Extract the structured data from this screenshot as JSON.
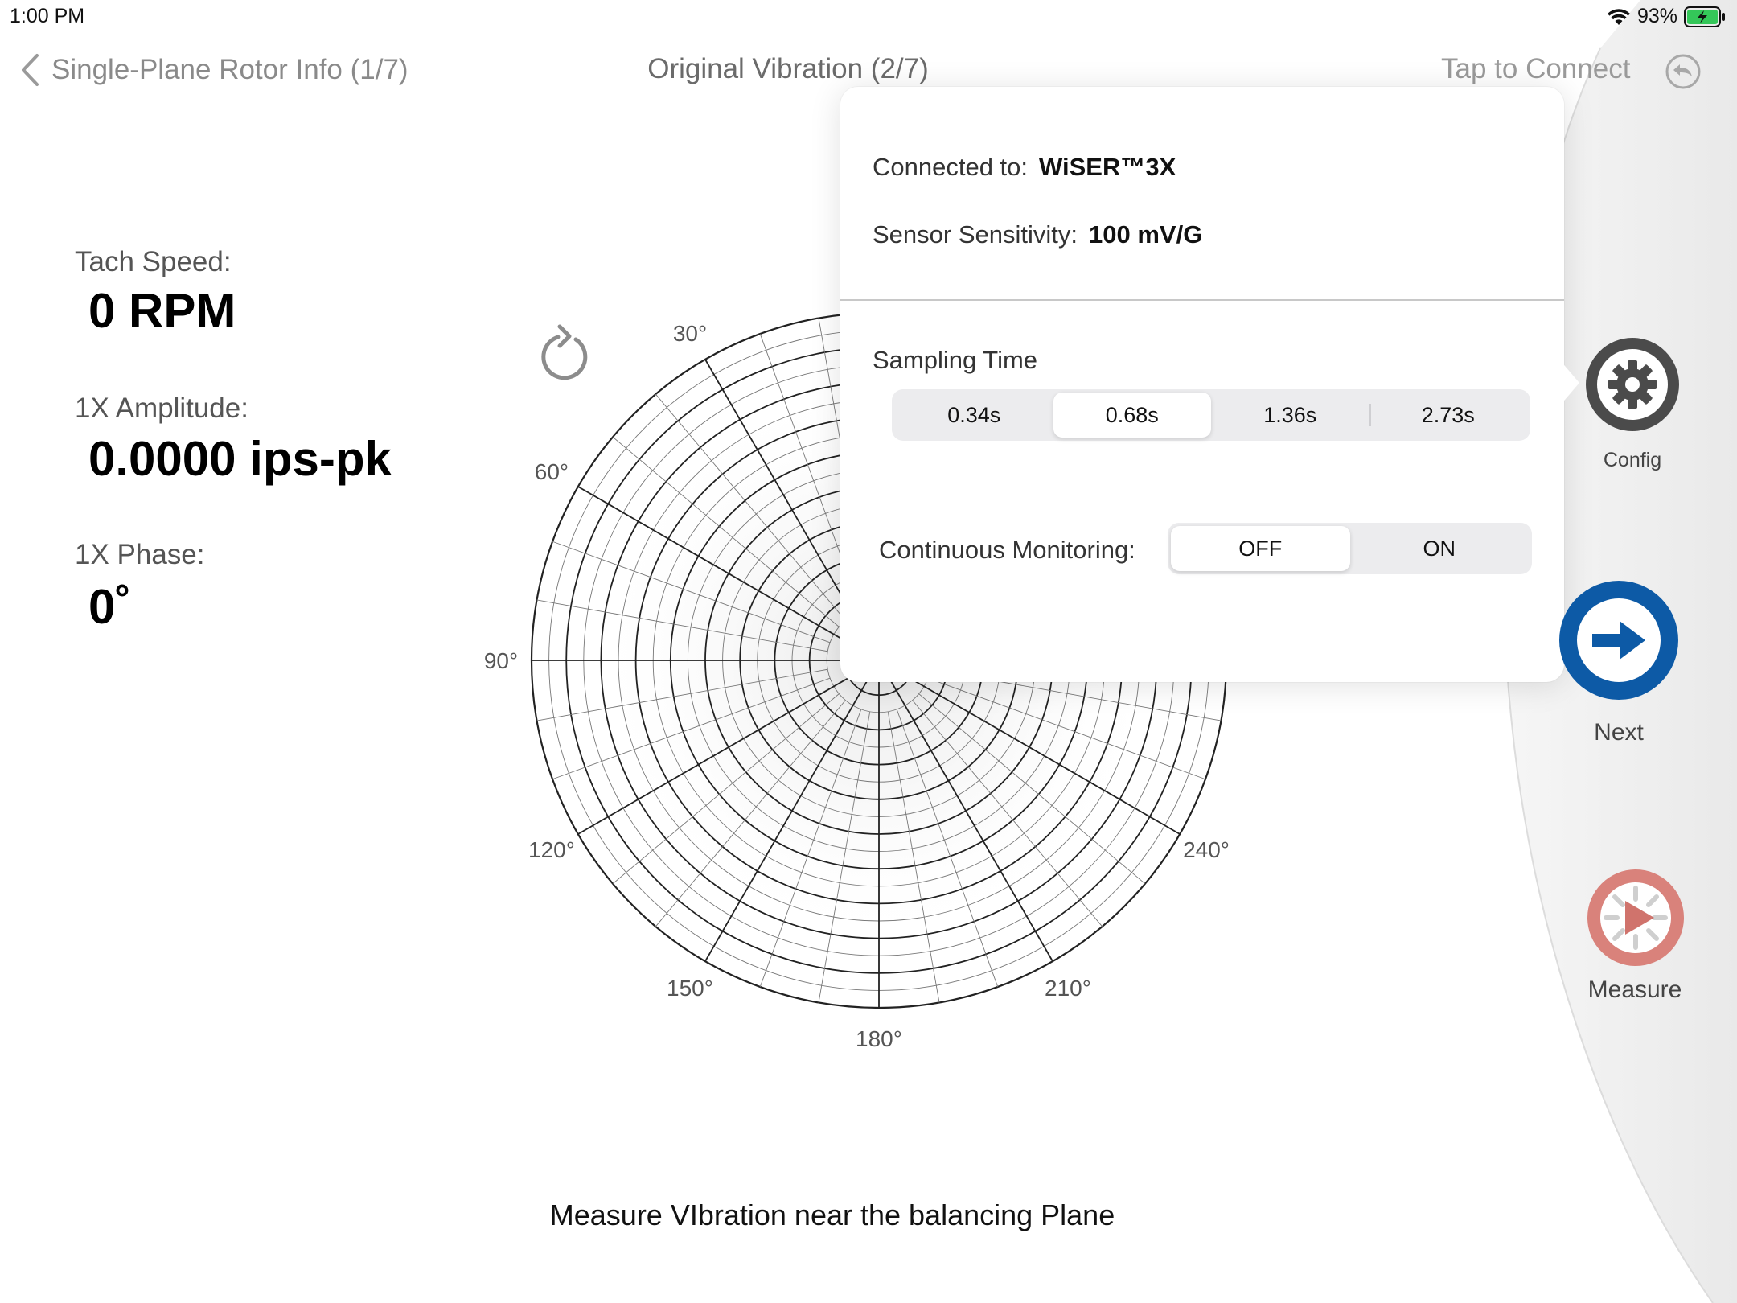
{
  "status_bar": {
    "time": "1:00 PM",
    "battery": "93%"
  },
  "nav": {
    "back_label": "Single-Plane Rotor Info (1/7)",
    "title": "Original Vibration (2/7)",
    "connect_label": "Tap to Connect"
  },
  "readouts": {
    "tach_label": "Tach Speed:",
    "tach_value": "0 RPM",
    "amplitude_label": "1X Amplitude:",
    "amplitude_value": "0.0000 ips-pk",
    "phase_label": "1X Phase:",
    "phase_value": "0˚"
  },
  "polar": {
    "angle_labels": [
      "30°",
      "60°",
      "90°",
      "120°",
      "150°",
      "180°",
      "210°",
      "240°"
    ]
  },
  "caption": "Measure VIbration near the balancing Plane",
  "popover": {
    "connected_label": "Connected to:",
    "connected_value": "WiSER™3X",
    "sensitivity_label": "Sensor Sensitivity:",
    "sensitivity_value": "100 mV/G",
    "sampling_label": "Sampling Time",
    "sampling_options": [
      "0.34s",
      "0.68s",
      "1.36s",
      "2.73s"
    ],
    "sampling_selected": "0.68s",
    "monitoring_label": "Continuous Monitoring:",
    "monitoring_options": [
      "OFF",
      "ON"
    ],
    "monitoring_selected": "OFF"
  },
  "controls": {
    "config_label": "Config",
    "next_label": "Next",
    "measure_label": "Measure"
  },
  "colors": {
    "next_blue": "#0d5aa6",
    "measure_red": "#d9827b",
    "config_gray": "#4b4b4b",
    "battery_green": "#34c759"
  }
}
